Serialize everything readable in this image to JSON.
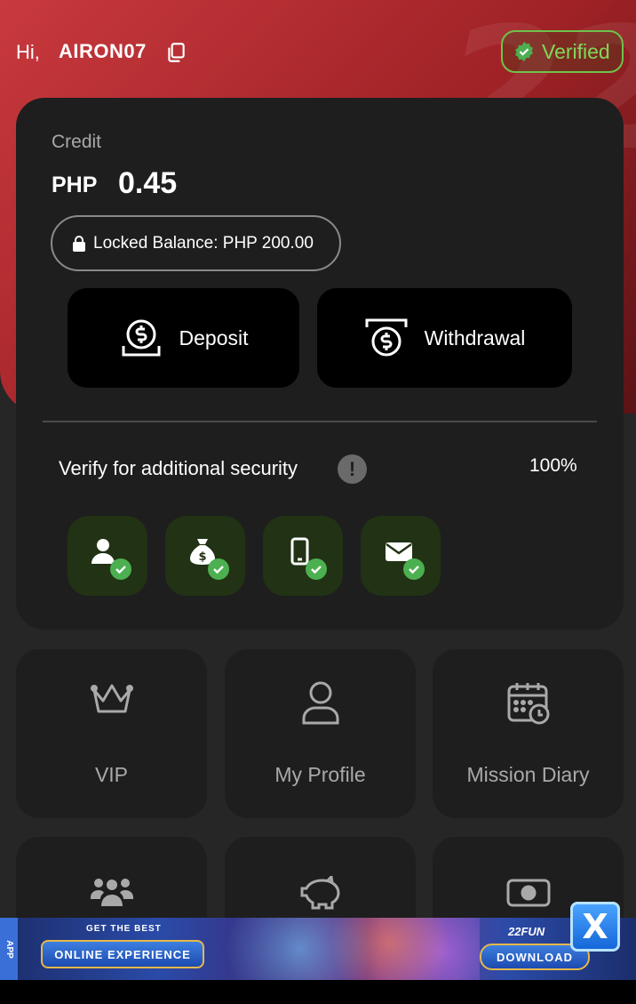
{
  "header": {
    "greeting": "Hi,",
    "username": "AIRON07",
    "verified_label": "Verified"
  },
  "wallet": {
    "credit_label": "Credit",
    "currency": "PHP",
    "amount": "0.45",
    "locked_balance": "Locked Balance: PHP 200.00",
    "deposit_label": "Deposit",
    "withdrawal_label": "Withdrawal"
  },
  "security": {
    "label": "Verify for additional security",
    "info_glyph": "!",
    "percent": "100%",
    "items": [
      {
        "icon": "user-icon",
        "verified": true
      },
      {
        "icon": "money-bag-icon",
        "verified": true
      },
      {
        "icon": "phone-icon",
        "verified": true
      },
      {
        "icon": "email-icon",
        "verified": true
      }
    ]
  },
  "menu": {
    "tiles": [
      {
        "label": "VIP",
        "icon": "crown-icon"
      },
      {
        "label": "My Profile",
        "icon": "profile-icon"
      },
      {
        "label": "Mission Diary",
        "icon": "calendar-clock-icon"
      },
      {
        "label": "",
        "icon": "group-icon"
      },
      {
        "label": "",
        "icon": "piggy-bank-icon"
      },
      {
        "label": "",
        "icon": "cash-icon"
      }
    ]
  },
  "banner": {
    "side_tab": "APP",
    "headline": "GET THE BEST",
    "subline": "ONLINE EXPERIENCE",
    "brand": "22FUN",
    "cta": "DOWNLOAD",
    "close_glyph": "X"
  },
  "colors": {
    "hero": "#b62e33",
    "card": "#1e1e1e",
    "background": "#262626",
    "accent_green": "#7ed957",
    "check_green": "#4caf50"
  }
}
